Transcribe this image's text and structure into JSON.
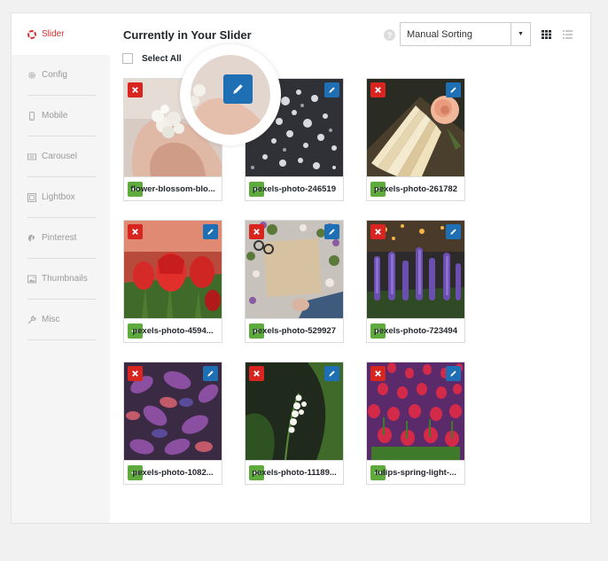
{
  "sidebar": {
    "items": [
      {
        "label": "Slider",
        "icon": "lifebuoy-icon",
        "active": true
      },
      {
        "label": "Config",
        "icon": "gear-icon"
      },
      {
        "label": "Mobile",
        "icon": "mobile-icon"
      },
      {
        "label": "Carousel",
        "icon": "carousel-icon"
      },
      {
        "label": "Lightbox",
        "icon": "lightbox-icon"
      },
      {
        "label": "Pinterest",
        "icon": "pinterest-icon"
      },
      {
        "label": "Thumbnails",
        "icon": "image-icon"
      },
      {
        "label": "Misc",
        "icon": "wrench-icon"
      }
    ]
  },
  "header": {
    "title": "Currently in Your Slider",
    "help": "?",
    "sort": {
      "selected": "Manual Sorting"
    }
  },
  "select_all": {
    "label": "Select All"
  },
  "images": [
    {
      "caption": "flower-blossom-blo...",
      "scene": "hand-blossom"
    },
    {
      "caption": "pexels-photo-246519",
      "scene": "white-blossoms"
    },
    {
      "caption": "pexels-photo-261782",
      "scene": "book-rose"
    },
    {
      "caption": "pexels-photo-4594...",
      "scene": "red-tulips"
    },
    {
      "caption": "pexels-photo-529927",
      "scene": "desk-flowers"
    },
    {
      "caption": "pexels-photo-723494",
      "scene": "lupines"
    },
    {
      "caption": "pexels-photo-1082...",
      "scene": "purple-leaves"
    },
    {
      "caption": "pexels-photo-11189...",
      "scene": "lily-valley"
    },
    {
      "caption": "tulips-spring-light-...",
      "scene": "tulip-field"
    }
  ],
  "colors": {
    "accent_red": "#d8251f",
    "accent_blue": "#1e6fb4",
    "accent_green": "#5faa3c",
    "active_sidebar": "#d4302e"
  }
}
